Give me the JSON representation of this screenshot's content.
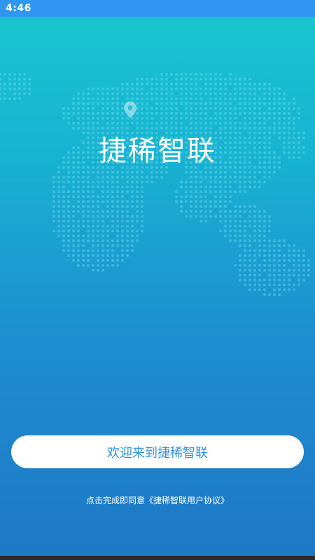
{
  "status_bar": {
    "time": "4:46"
  },
  "app": {
    "title": "捷稀智联"
  },
  "welcome_button": {
    "label": "欢迎来到捷稀智联"
  },
  "agreement": {
    "prefix": "点击完成即同意",
    "link": "《捷稀智联用户协议》"
  },
  "colors": {
    "status_bar": "#2f97f2",
    "gradient_top": "#19c7cf",
    "gradient_bottom": "#1f77c6",
    "button_text": "#2f92e6"
  },
  "icons": {
    "map": "world-map-dots",
    "pin": "location-pin-icon"
  }
}
